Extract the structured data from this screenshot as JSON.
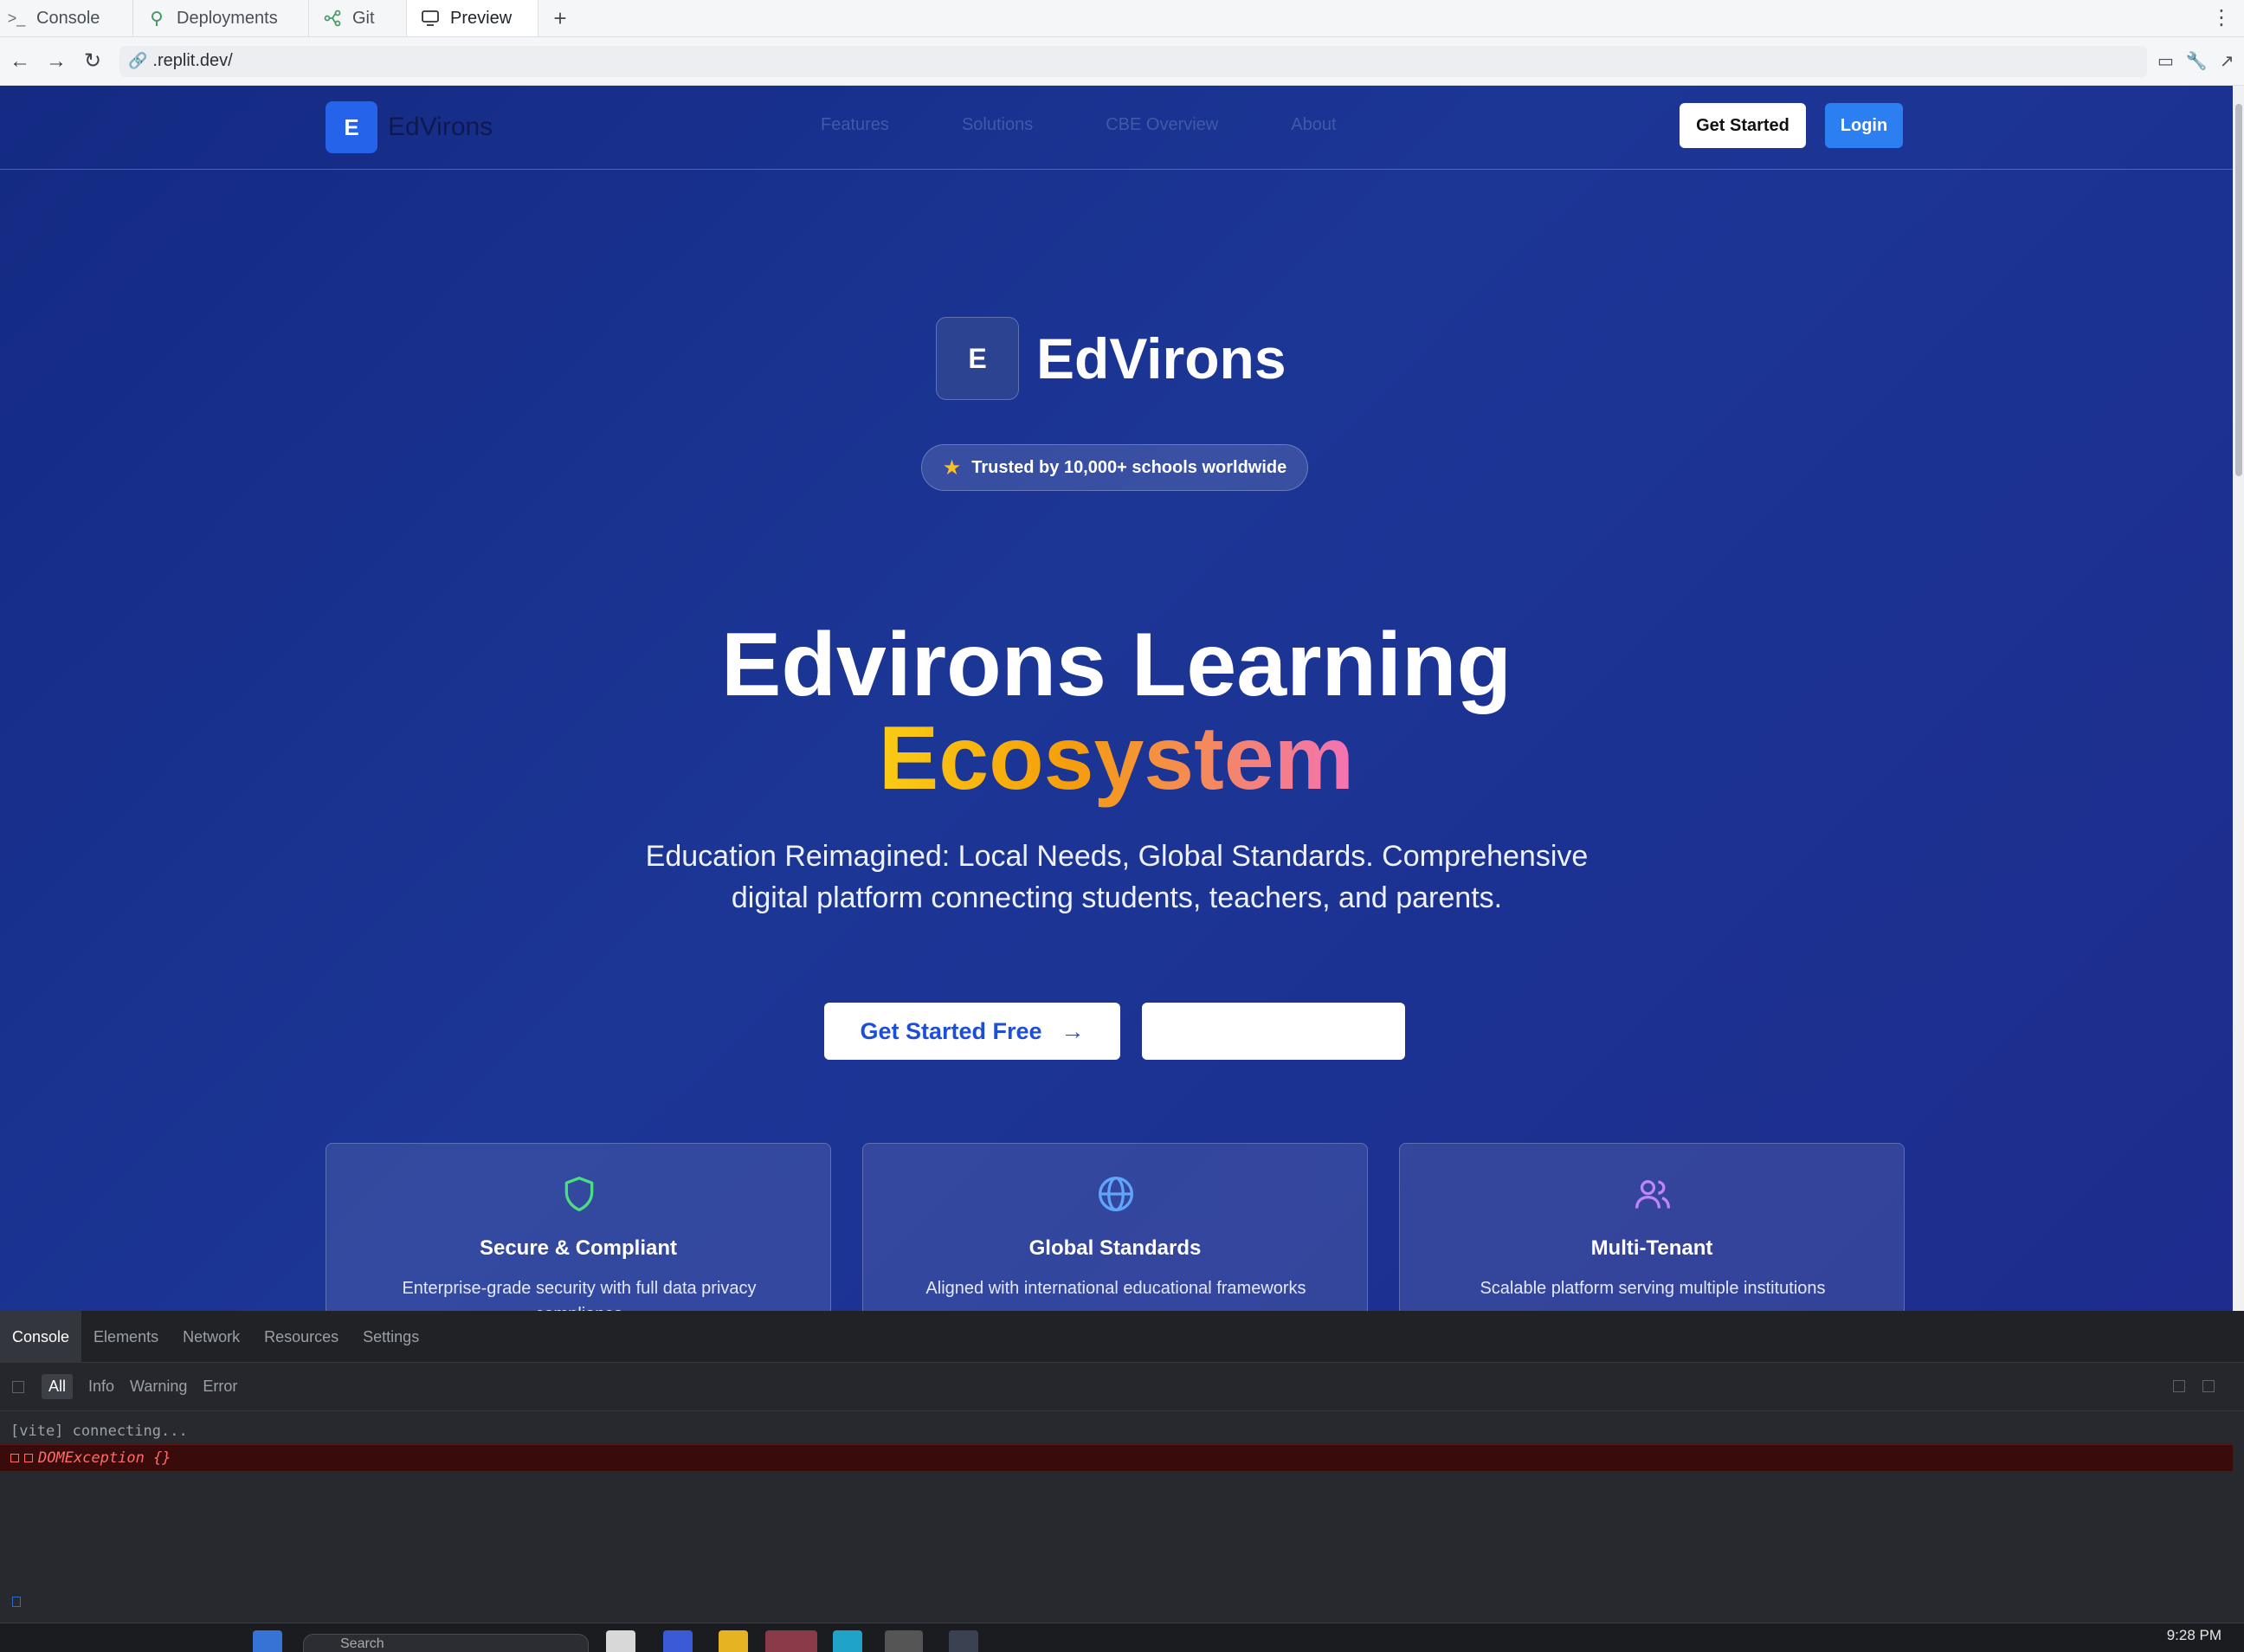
{
  "tabs": [
    {
      "label": "Console",
      "icon": "terminal-icon"
    },
    {
      "label": "Deployments",
      "icon": "deployments-icon"
    },
    {
      "label": "Git",
      "icon": "git-icon"
    },
    {
      "label": "Preview",
      "icon": "monitor-icon"
    }
  ],
  "tab_add": "+",
  "url": ".replit.dev/",
  "site": {
    "brand_letter": "E",
    "brand_name": "EdVirons",
    "nav": [
      "Features",
      "Solutions",
      "CBE Overview",
      "About"
    ],
    "get_started": "Get Started",
    "login": "Login"
  },
  "hero": {
    "logo_letter": "E",
    "logo_name": "EdVirons",
    "trust_text": "Trusted by 10,000+ schools worldwide",
    "title_line1": "Edvirons Learning",
    "title_line2": "Ecosystem",
    "subtitle": "Education Reimagined: Local Needs, Global Standards. Comprehensive digital platform connecting students, teachers, and parents.",
    "cta_primary": "Get Started Free",
    "cta_secondary": ""
  },
  "features": [
    {
      "title": "Secure & Compliant",
      "desc": "Enterprise-grade security with full data privacy compliance",
      "icon": "shield-icon",
      "color": "#4ade80"
    },
    {
      "title": "Global Standards",
      "desc": "Aligned with international educational frameworks",
      "icon": "globe-icon",
      "color": "#60a5fa"
    },
    {
      "title": "Multi-Tenant",
      "desc": "Scalable platform serving multiple institutions",
      "icon": "users-icon",
      "color": "#c084fc"
    }
  ],
  "devtools": {
    "tabs": [
      "Console",
      "Elements",
      "Network",
      "Resources",
      "Settings"
    ],
    "filters": [
      "All",
      "Info",
      "Warning",
      "Error"
    ],
    "log": "[vite] connecting...",
    "error": "DOMException {}"
  },
  "taskbar": {
    "search_placeholder": "Search",
    "clock": "9:28 PM"
  },
  "colors": {
    "hero_bg": "#1c3696",
    "brand_blue": "#2563eb",
    "login_blue": "#2c7ff0",
    "accent_gradient_start": "#facc15",
    "accent_gradient_end": "#f472b6"
  }
}
